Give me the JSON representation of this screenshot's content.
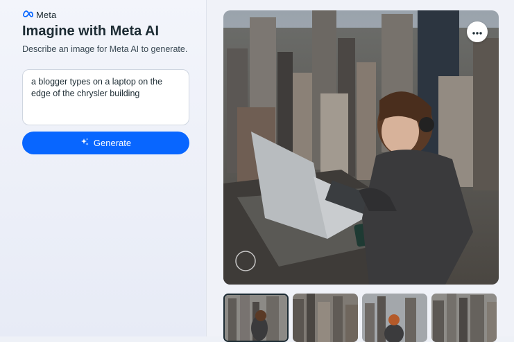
{
  "brand": {
    "name": "Meta",
    "color": "#0866ff"
  },
  "page": {
    "title": "Imagine with Meta AI",
    "subtitle": "Describe an image for Meta AI to generate."
  },
  "prompt": {
    "value": "a blogger types on a laptop on the edge of the chrysler building"
  },
  "generate": {
    "label": "Generate",
    "icon": "sparkle-icon"
  },
  "result": {
    "more_icon": "more-horizontal-icon",
    "thumbnails": [
      {
        "selected": true
      },
      {
        "selected": false
      },
      {
        "selected": false
      },
      {
        "selected": false
      }
    ]
  }
}
